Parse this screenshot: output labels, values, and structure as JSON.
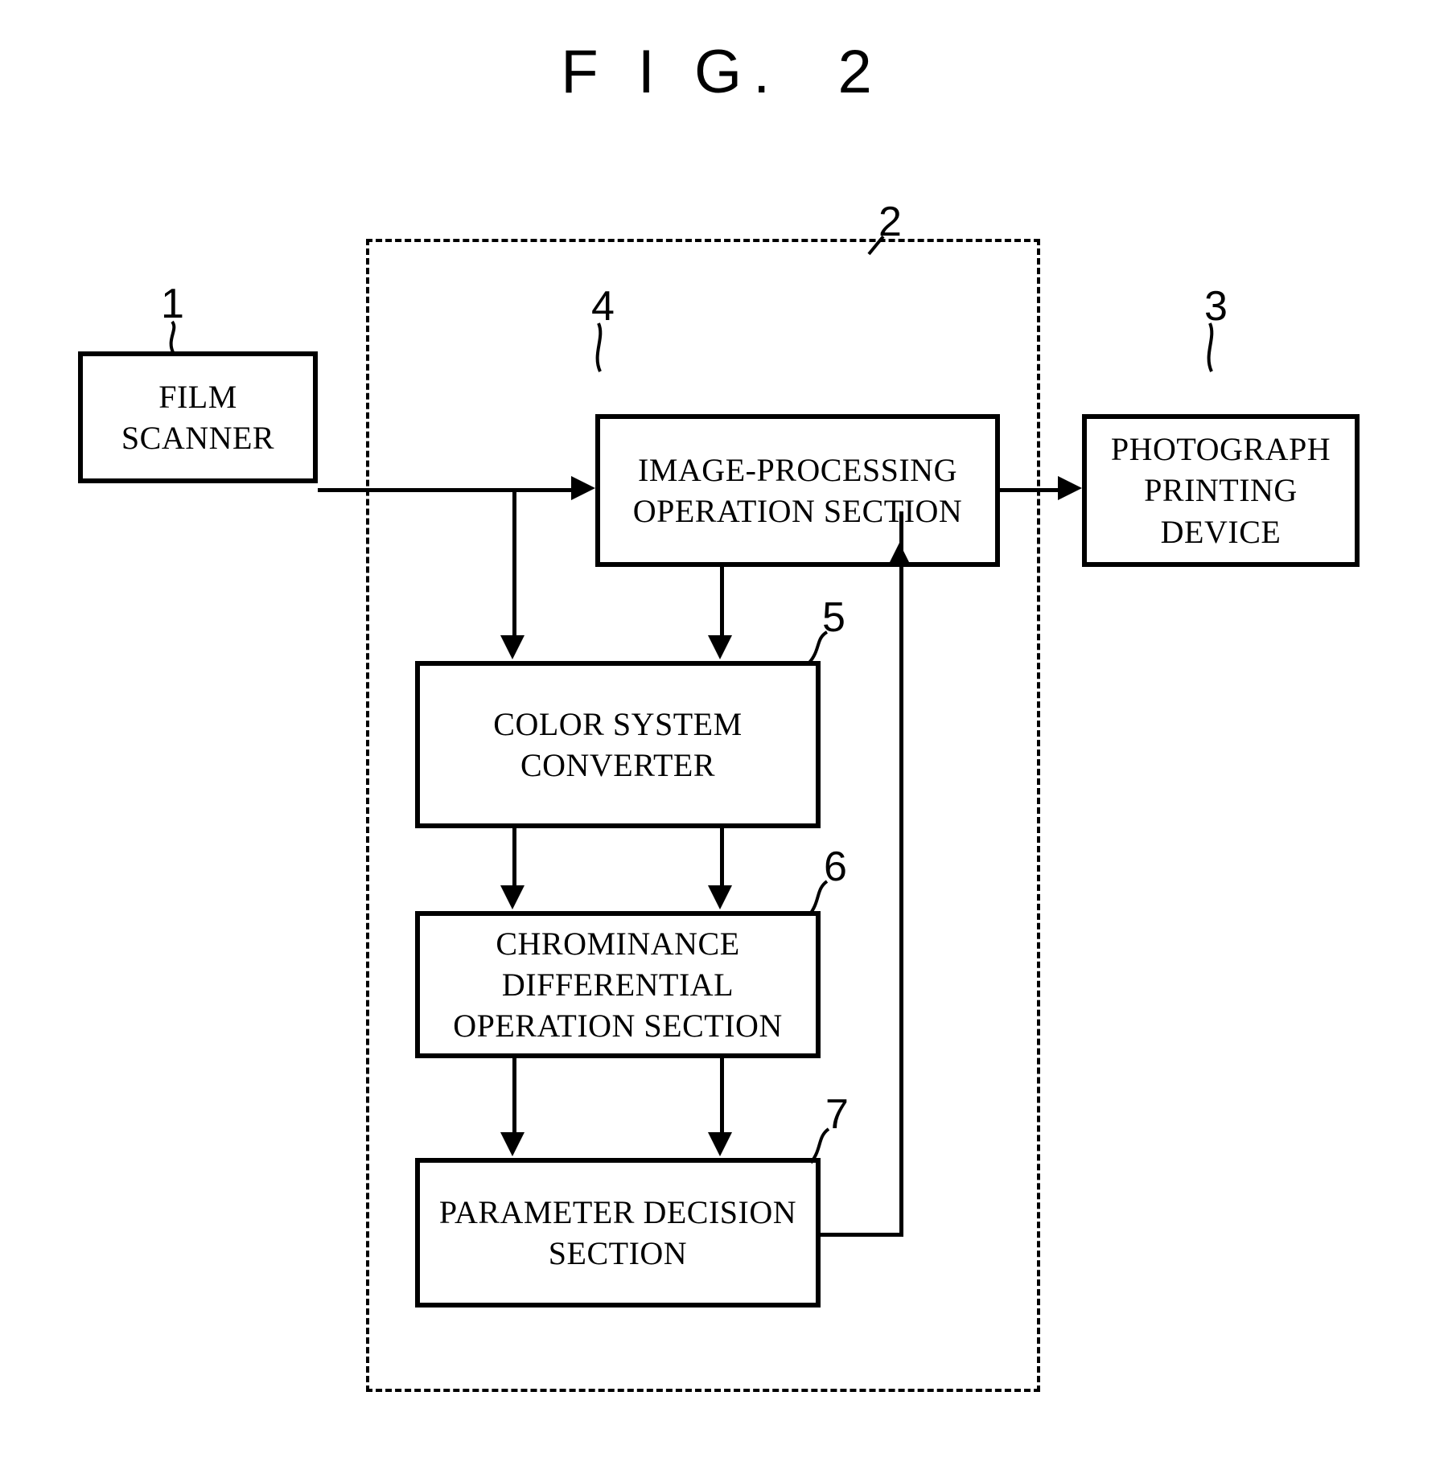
{
  "figure": {
    "title": "F I G.  2"
  },
  "nodes": [
    {
      "id": "film-scanner",
      "ref": "1",
      "label": "FILM\nSCANNER"
    },
    {
      "id": "image-processing-operation-section",
      "ref": "4",
      "label": "IMAGE-PROCESSING\nOPERATION SECTION"
    },
    {
      "id": "photograph-printing-device",
      "ref": "3",
      "label": "PHOTOGRAPH\nPRINTING\nDEVICE"
    },
    {
      "id": "color-system-converter",
      "ref": "5",
      "label": "COLOR SYSTEM\nCONVERTER"
    },
    {
      "id": "chrominance-differential-operation-section",
      "ref": "6",
      "label": "CHROMINANCE\nDIFFERENTIAL\nOPERATION SECTION"
    },
    {
      "id": "parameter-decision-section",
      "ref": "7",
      "label": "PARAMETER DECISION\nSECTION"
    }
  ],
  "enclosure": {
    "id": "image-processing-unit",
    "ref": "2"
  },
  "colors": {
    "ink": "#000000",
    "paper": "#ffffff"
  }
}
